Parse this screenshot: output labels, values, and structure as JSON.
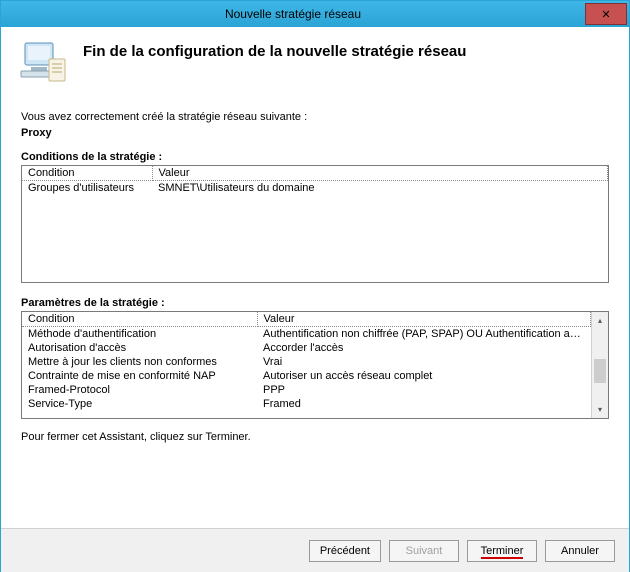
{
  "window": {
    "title": "Nouvelle stratégie réseau",
    "close_glyph": "✕"
  },
  "header": {
    "heading": "Fin de la configuration de la nouvelle stratégie réseau"
  },
  "intro": "Vous avez correctement créé la stratégie réseau suivante :",
  "policy_name": "Proxy",
  "conditions": {
    "label": "Conditions de la stratégie :",
    "columns": {
      "c1": "Condition",
      "c2": "Valeur"
    },
    "rows": [
      {
        "c1": "Groupes d'utilisateurs",
        "c2": "SMNET\\Utilisateurs du domaine"
      }
    ]
  },
  "params": {
    "label": "Paramètres de la stratégie :",
    "columns": {
      "c1": "Condition",
      "c2": "Valeur"
    },
    "rows": [
      {
        "c1": "Méthode d'authentification",
        "c2": "Authentification non chiffrée (PAP, SPAP) OU Authentification avec chiffre..."
      },
      {
        "c1": "Autorisation d'accès",
        "c2": "Accorder l'accès"
      },
      {
        "c1": "Mettre à jour les clients non conformes",
        "c2": "Vrai"
      },
      {
        "c1": "Contrainte de mise en conformité NAP",
        "c2": "Autoriser un accès réseau complet"
      },
      {
        "c1": "Framed-Protocol",
        "c2": "PPP"
      },
      {
        "c1": "Service-Type",
        "c2": "Framed"
      }
    ]
  },
  "closing": "Pour fermer cet Assistant, cliquez sur Terminer.",
  "buttons": {
    "prev": "Précédent",
    "next": "Suivant",
    "finish": "Terminer",
    "cancel": "Annuler"
  }
}
